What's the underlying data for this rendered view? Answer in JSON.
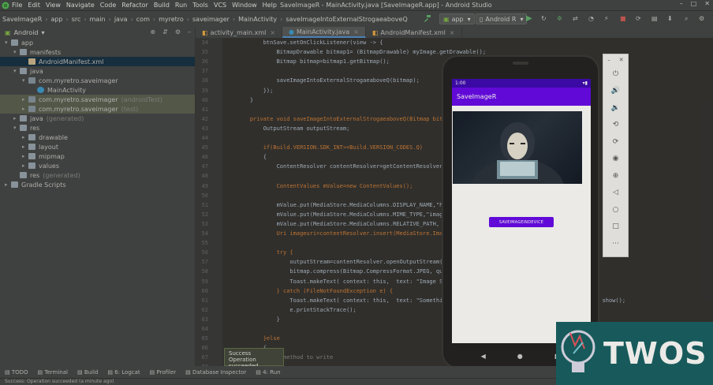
{
  "menubar": {
    "items": [
      "File",
      "Edit",
      "View",
      "Navigate",
      "Code",
      "Refactor",
      "Build",
      "Run",
      "Tools",
      "VCS",
      "Window",
      "Help"
    ],
    "title": "SaveImageR - MainActivity.java [SaveImageR.app] - Android Studio"
  },
  "breadcrumbs": [
    "SaveImageR",
    "app",
    "src",
    "main",
    "java",
    "com",
    "myretro",
    "saveimager",
    "MainActivity",
    "saveImageIntoExternalStrogaeaboveQ"
  ],
  "toolbar": {
    "run_config": "app",
    "device": "Android R"
  },
  "project": {
    "view_label": "Android",
    "tree": [
      {
        "label": "app",
        "indent": 0,
        "arrow": "▾",
        "icon": "folder"
      },
      {
        "label": "manifests",
        "indent": 1,
        "arrow": "▾",
        "icon": "folder"
      },
      {
        "label": "AndroidManifest.xml",
        "indent": 2,
        "arrow": "",
        "icon": "file",
        "state": "sel"
      },
      {
        "label": "java",
        "indent": 1,
        "arrow": "▾",
        "icon": "folder"
      },
      {
        "label": "com.myretro.saveimager",
        "indent": 2,
        "arrow": "▾",
        "icon": "pkg"
      },
      {
        "label": "MainActivity",
        "indent": 3,
        "arrow": "",
        "icon": "act"
      },
      {
        "label": "com.myretro.saveimager",
        "indent": 2,
        "arrow": "▸",
        "icon": "pkg",
        "suffix": "(androidTest)",
        "state": "hl"
      },
      {
        "label": "com.myretro.saveimager",
        "indent": 2,
        "arrow": "▸",
        "icon": "pkg",
        "suffix": "(test)",
        "state": "hl"
      },
      {
        "label": "java",
        "indent": 1,
        "arrow": "▸",
        "icon": "folder",
        "suffix": "(generated)"
      },
      {
        "label": "res",
        "indent": 1,
        "arrow": "▾",
        "icon": "folder"
      },
      {
        "label": "drawable",
        "indent": 2,
        "arrow": "▸",
        "icon": "folder"
      },
      {
        "label": "layout",
        "indent": 2,
        "arrow": "▸",
        "icon": "folder"
      },
      {
        "label": "mipmap",
        "indent": 2,
        "arrow": "▸",
        "icon": "folder"
      },
      {
        "label": "values",
        "indent": 2,
        "arrow": "▸",
        "icon": "folder"
      },
      {
        "label": "res",
        "indent": 1,
        "arrow": "",
        "icon": "folder",
        "suffix": "(generated)"
      },
      {
        "label": "Gradle Scripts",
        "indent": 0,
        "arrow": "▸",
        "icon": "folder"
      }
    ]
  },
  "editor": {
    "tabs": [
      "activity_main.xml",
      "MainActivity.java",
      "AndroidManifest.xml"
    ],
    "active_tab": 1,
    "first_line": 34,
    "lines": [
      "        btnSave.setOnClickListener(view -> {",
      "            BitmapDrawable bitmap1= (BitmapDrawable) myImage.getDrawable();",
      "            Bitmap bitmap=bitmap1.getBitmap();",
      "",
      "            saveImageIntoExternalStrogaeaboveQ(bitmap);",
      "        });",
      "    }",
      "",
      "    private void saveImageIntoExternalStrogaeaboveQ(Bitmap bitmap",
      "        OutputStream outputStream;",
      "",
      "        if(Build.VERSION.SDK_INT>=Build.VERSION_CODES.Q)",
      "        {",
      "            ContentResolver contentResolver=getContentResolver();",
      "",
      "            ContentValues mValue=new ContentValues();",
      "",
      "            mValue.put(MediaStore.MediaColumns.DISPLAY_NAME,\"hack",
      "            mValue.put(MediaStore.MediaColumns.MIME_TYPE,\"image/j",
      "            mValue.put(MediaStore.MediaColumns.RELATIVE_PATH, Env",
      "            Uri imageuri=contentResolver.insert(MediaStore.Images",
      "",
      "            try {",
      "                outputStream=contentResolver.openOutputStream(ima",
      "                bitmap.compress(Bitmap.CompressFormat.JPEG, quality",
      "                Toast.makeText( context: this,  text: \"Image Saved Su",
      "            } catch (FileNotFoundException e) {",
      "                Toast.makeText( context: this,  text: \"Something went                                         show();",
      "                e.printStackTrace();",
      "            }",
      "",
      "        }else",
      "        {",
      "            //method to write",
      "",
      ""
    ]
  },
  "emulator": {
    "status_time": "1:00",
    "app_title": "SaveImageR",
    "button_label": "SAVEIMAGEINDEVICE"
  },
  "toolwindows": [
    "TODO",
    "Terminal",
    "Build",
    "6: Logcat",
    "Profiler",
    "Database Inspector",
    "4: Run"
  ],
  "toast": {
    "title": "Success",
    "message": "Operation succeeded"
  },
  "statusbar": "Success: Operation succeeded (a minute ago)",
  "watermark": "TWOS"
}
